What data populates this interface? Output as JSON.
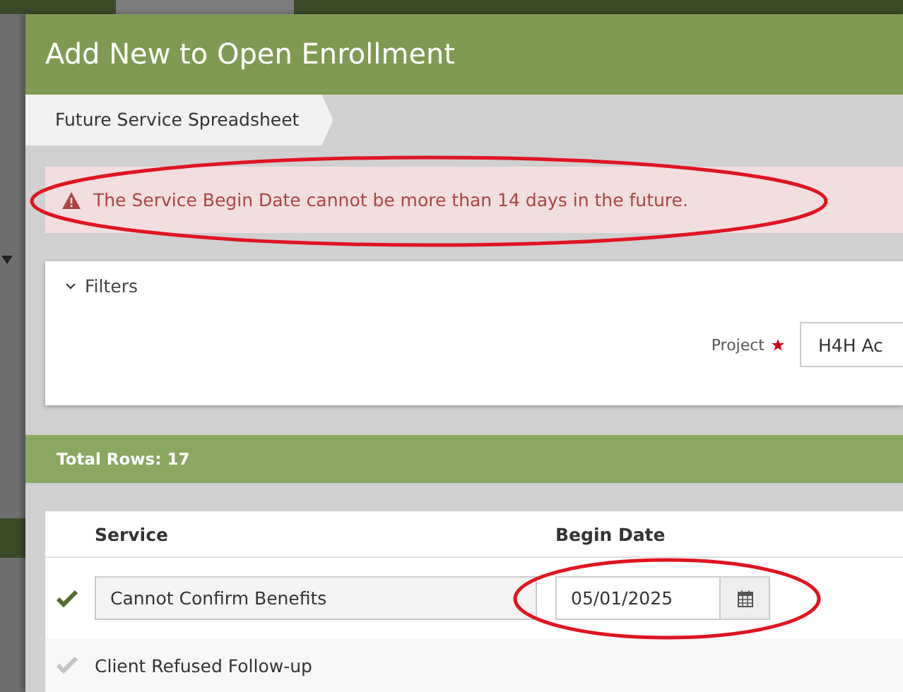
{
  "modal": {
    "title": "Add New to Open Enrollment"
  },
  "breadcrumbs": [
    {
      "label": "Future Service Spreadsheet",
      "selected": true
    }
  ],
  "alert": {
    "message": "The Service Begin Date cannot be more than 14 days in the future.",
    "circled": true
  },
  "filters": {
    "title": "Filters",
    "expanded": true,
    "project_label": "Project",
    "required": true,
    "project_value": "H4H Ac"
  },
  "summary": "Total Rows: 17",
  "table": {
    "columns": [
      "Service",
      "Begin Date"
    ],
    "rows": [
      {
        "kind": "editable",
        "checked": true,
        "service": "Cannot Confirm Benefits",
        "begin_date": "05/01/2025",
        "circled": true
      },
      {
        "kind": "plain",
        "checked": false,
        "service": "Client Refused Follow-up"
      }
    ]
  }
}
